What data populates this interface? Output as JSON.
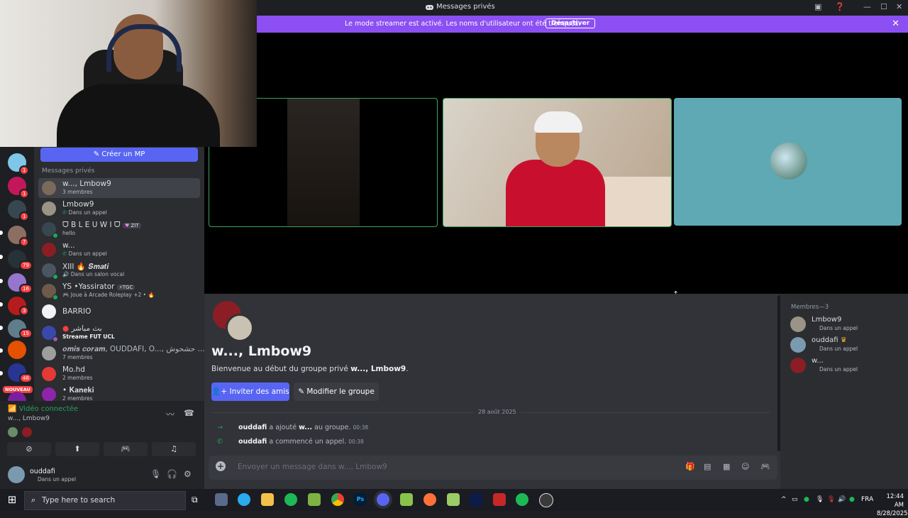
{
  "window": {
    "title": "Messages privés",
    "controls": [
      "—",
      "☐",
      "✕"
    ]
  },
  "banner": {
    "message": "Le mode streamer est activé. Les noms d'utilisateur ont été tronqués.",
    "button": "Désactiver"
  },
  "sidebar": {
    "create_dm": "Créer un MP",
    "section_label": "Messages privés",
    "new_badge": "NOUVEAU",
    "guild_badges": [
      "1",
      "1",
      "1",
      "7",
      "79",
      "16",
      "3",
      "15",
      "48"
    ],
    "dms": [
      {
        "name": "w..., Lmbow9",
        "sub": "3 membres"
      },
      {
        "name": "Lmbow9",
        "sub": "Dans un appel"
      },
      {
        "name": "ᗜ B L E U W I ᗜ",
        "tag": "ZIT",
        "sub": "hello"
      },
      {
        "name": "w...",
        "sub": "Dans un appel"
      },
      {
        "name": "XIII 🔥 𝑺𝒎𝒂𝒕𝒊",
        "sub": "Dans un salon vocal"
      },
      {
        "name": "YS •Yassirator",
        "tag": "TGC",
        "sub": "Joue à Arcade Roleplay +2 • 🔥"
      },
      {
        "name": "BARRIO",
        "sub": ""
      },
      {
        "name": "بث مباشر",
        "sub": "Streame FUT UCL"
      },
      {
        "name": "𝒐𝒎𝒊𝒔 𝒄𝒐𝒓𝒂𝒎, OUDDAFI, O..., حشحوش ...",
        "sub": "7 membres"
      },
      {
        "name": "Mo.hd",
        "sub": "2 membres"
      },
      {
        "name": "• 𝐊𝐚𝐧𝐞𝐤𝐢",
        "sub": "2 membres"
      }
    ]
  },
  "voice": {
    "status": "Vidéo connectée",
    "channel": "w..., Lmbow9"
  },
  "user": {
    "name": "ouddafi",
    "status": "Dans un appel"
  },
  "chat": {
    "group_title": "w..., Lmbow9",
    "welcome_prefix": "Bienvenue au début du groupe privé",
    "welcome_name": "w..., Lmbow9",
    "welcome_suffix": ".",
    "invite_button": "Inviter des amis",
    "edit_button": "Modifier le groupe",
    "date": "28 août 2025",
    "events": [
      {
        "actor": "ouddafi",
        "text": "a ajouté",
        "target": "w...",
        "text2": "au groupe.",
        "time": "00:38"
      },
      {
        "actor": "ouddafi",
        "text": "a commencé un appel.",
        "target": "",
        "text2": "",
        "time": "00:38"
      }
    ],
    "input_placeholder": "Envoyer un message dans w..., Lmbow9"
  },
  "members": {
    "header": "Membres—3",
    "list": [
      {
        "name": "Lmbow9",
        "status": "Dans un appel"
      },
      {
        "name": "ouddafi",
        "status": "Dans un appel"
      },
      {
        "name": "w...",
        "status": "Dans un appel"
      }
    ]
  },
  "taskbar": {
    "search_placeholder": "Type here to search",
    "language": "FRA",
    "time": "12:44 AM",
    "date": "8/28/2025"
  },
  "colors": {
    "accent": "#5865f2",
    "banner": "#8c4ff2",
    "online": "#23a55a",
    "badge": "#f23f43"
  }
}
